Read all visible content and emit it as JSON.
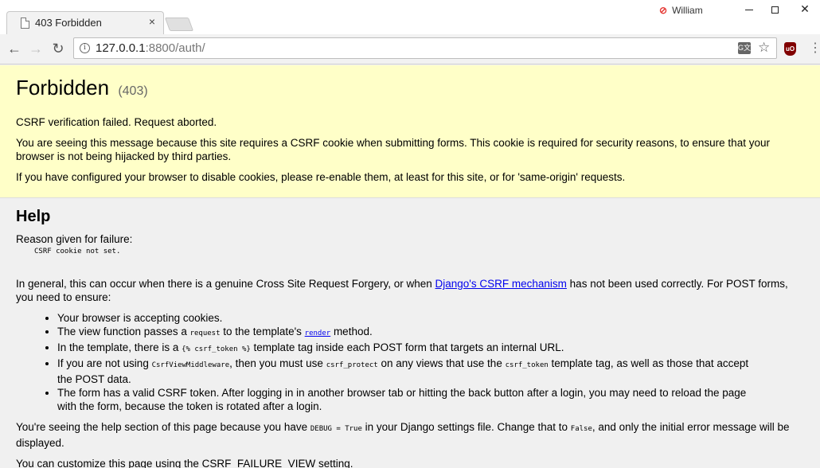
{
  "browser": {
    "tab_title": "403 Forbidden",
    "tab_close": "×",
    "profile_name": "William",
    "url_host": "127.0.0.1",
    "url_path": ":8800/auth/",
    "translate_label": "G文",
    "ublock_label": "uO"
  },
  "summary": {
    "title": "Forbidden",
    "code": "(403)",
    "message": "CSRF verification failed. Request aborted.",
    "explanation": "You are seeing this message because this site requires a CSRF cookie when submitting forms. This cookie is required for security reasons, to ensure that your browser is not being hijacked by third parties.",
    "cookies_note": "If you have configured your browser to disable cookies, please re-enable them, at least for this site, or for 'same-origin' requests."
  },
  "help": {
    "heading": "Help",
    "reason_label": "Reason given for failure:",
    "reason_value": "CSRF cookie not set.",
    "general_before": "In general, this can occur when there is a genuine Cross Site Request Forgery, or when ",
    "general_link": "Django's CSRF mechanism",
    "general_after": " has not been used correctly. For POST forms, you need to ensure:",
    "items": {
      "i1": "Your browser is accepting cookies.",
      "i2_a": "The view function passes a ",
      "i2_code": "request",
      "i2_b": " to the template's ",
      "i2_link": "render",
      "i2_c": " method.",
      "i3_a": "In the template, there is a ",
      "i3_code": "{% csrf_token %}",
      "i3_b": " template tag inside each POST form that targets an internal URL.",
      "i4_a": "If you are not using ",
      "i4_code1": "CsrfViewMiddleware",
      "i4_b": ", then you must use ",
      "i4_code2": "csrf_protect",
      "i4_c": " on any views that use the ",
      "i4_code3": "csrf_token",
      "i4_d": " template tag, as well as those that accept the POST data.",
      "i5": "The form has a valid CSRF token. After logging in in another browser tab or hitting the back button after a login, you may need to reload the page with the form, because the token is rotated after a login."
    },
    "debug_a": "You're seeing the help section of this page because you have ",
    "debug_code1": "DEBUG = True",
    "debug_b": " in your Django settings file. Change that to ",
    "debug_code2": "False",
    "debug_c": ", and only the initial error message will be displayed.",
    "customize": "You can customize this page using the CSRF_FAILURE_VIEW setting."
  }
}
